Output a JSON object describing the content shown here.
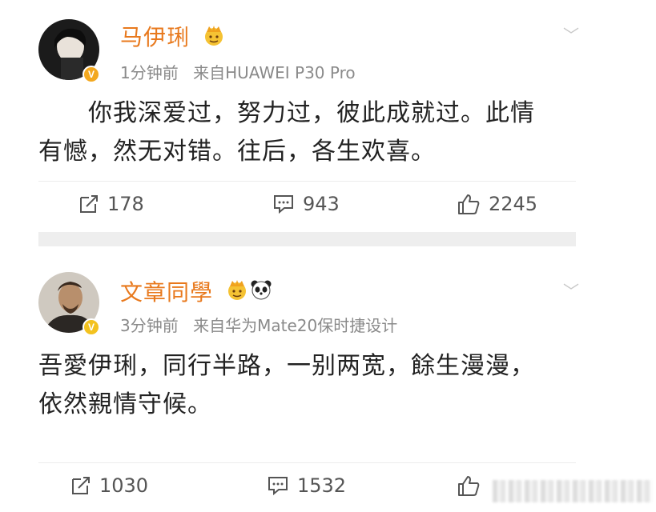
{
  "posts": [
    {
      "username": "马伊琍",
      "time": "1分钟前",
      "source": "来自HUAWEI P30 Pro",
      "text_line1": "你我深爱过，努力过，彼此成就过。此情",
      "text_line2": "有憾，然无对错。往后，各生欢喜。",
      "repost_count": "178",
      "comment_count": "943",
      "like_count": "2245",
      "badge": "V",
      "badge_color": "#f3a81f"
    },
    {
      "username": "文章同學",
      "time": "3分钟前",
      "source": "来自华为Mate20保时捷设计",
      "text_line1": "吾愛伊琍，同行半路，一别两宽，餘生漫漫，",
      "text_line2": "依然親情守候。",
      "repost_count": "1030",
      "comment_count": "1532",
      "badge": "V",
      "badge_color": "#f3c21f"
    }
  ],
  "colors": {
    "username": "#e8791d",
    "meta": "#8a8a8a",
    "divider": "#eeeeee"
  },
  "icons": [
    "repost-icon",
    "comment-icon",
    "like-icon",
    "chevron-down-icon",
    "vip-v-badge-icon",
    "crown-emoji-icon",
    "panda-emoji-icon"
  ]
}
